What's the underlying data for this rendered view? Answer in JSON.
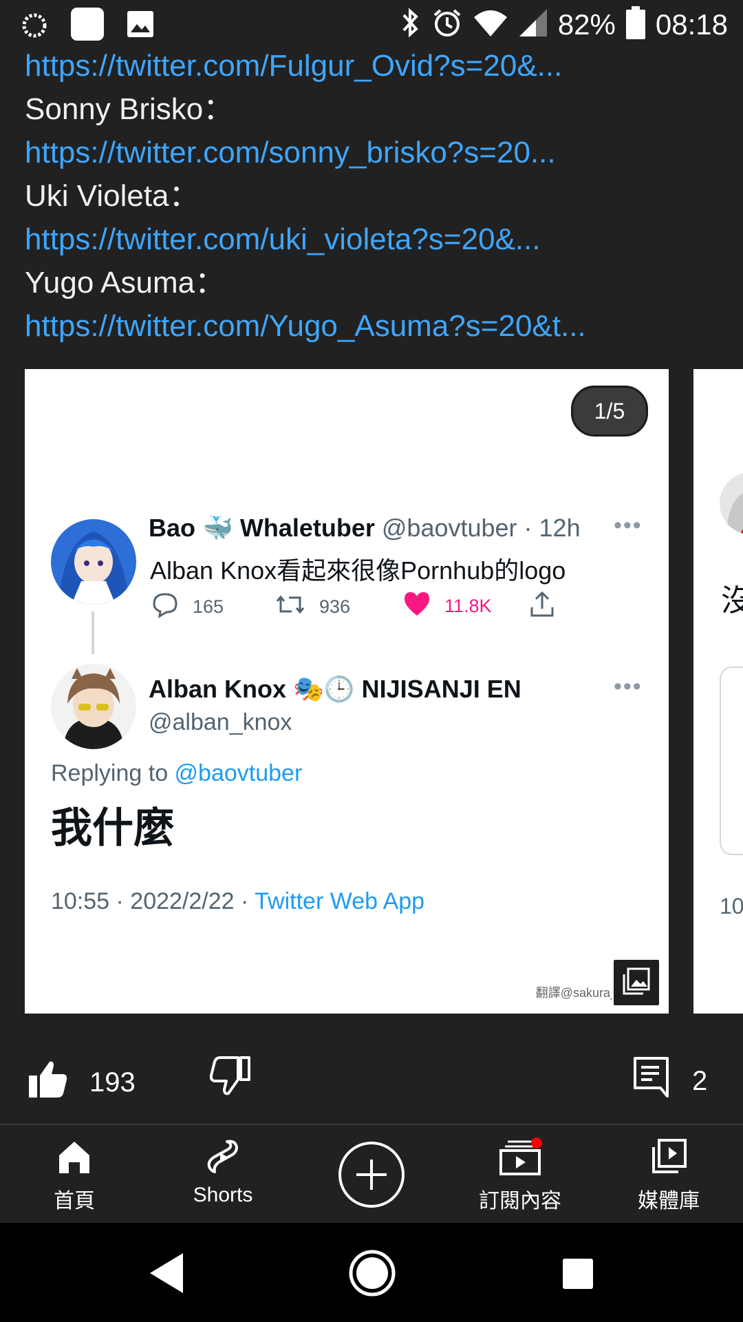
{
  "status_bar": {
    "battery": "82%",
    "time": "08:18"
  },
  "links": [
    {
      "name": "",
      "url": "https://twitter.com/Fulgur_Ovid?s=20&..."
    },
    {
      "name": "Sonny Brisko：",
      "url": "https://twitter.com/sonny_brisko?s=20..."
    },
    {
      "name": "Uki Violeta：",
      "url": "https://twitter.com/uki_violeta?s=20&..."
    },
    {
      "name": "Yugo Asuma：",
      "url": "https://twitter.com/Yugo_Asuma?s=20&t..."
    }
  ],
  "carousel": {
    "counter": "1/5",
    "tweet1": {
      "display_name": "Bao 🐳 Whaletuber",
      "handle": "@baovtuber · 12h",
      "text": "Alban Knox看起來很像Pornhub的logo",
      "replies": "165",
      "retweets": "936",
      "likes": "11.8K"
    },
    "tweet2": {
      "display_name": "Alban Knox 🎭🕒 NIJISANJI EN",
      "handle": "@alban_knox",
      "replying_prefix": "Replying to ",
      "replying_handle": "@baovtuber",
      "text": "我什麼",
      "timestamp": "10:55 · 2022/2/22 · ",
      "source": "Twitter Web App"
    },
    "watermark": "翻譯@sakura_to",
    "next_card_text": "沒",
    "next_card_time": "10"
  },
  "actions": {
    "likes": "193",
    "comments": "2"
  },
  "nav": {
    "home": "首頁",
    "shorts": "Shorts",
    "subscriptions": "訂閱內容",
    "library": "媒體庫"
  },
  "colors": {
    "background": "#212121",
    "link": "#3ea6ff",
    "like_pink": "#f91880",
    "badge_red": "#ff0000"
  }
}
